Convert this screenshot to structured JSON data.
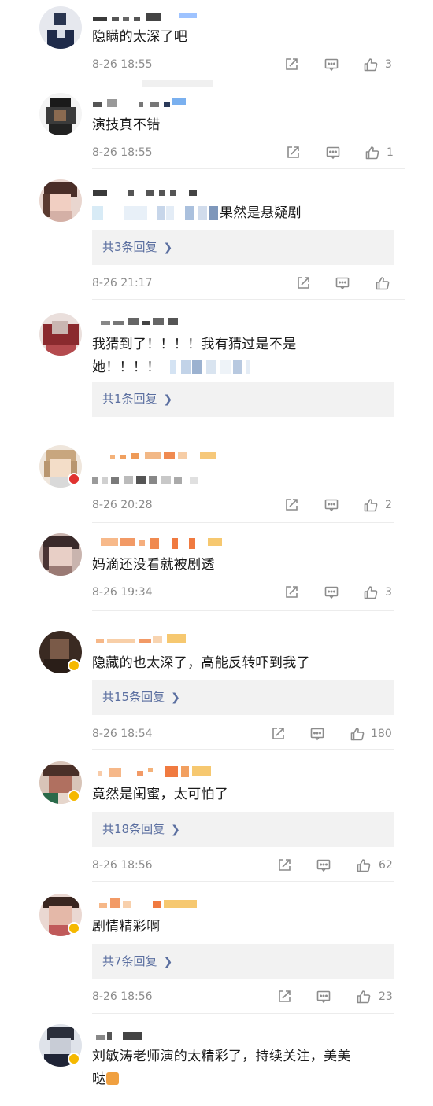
{
  "comments": [
    {
      "text": "隐瞒的太深了吧",
      "time": "8-26 18:55",
      "likes": "3"
    },
    {
      "text": "演技真不错",
      "time": "8-26 18:55",
      "likes": "1"
    },
    {
      "text": "果然是悬疑剧",
      "reply": "共3条回复",
      "time": "8-26 21:17",
      "likes": ""
    },
    {
      "text_line1": "我猜到了！！！！我有猜过是不是",
      "text_line2": "她！！！！",
      "reply": "共1条回复"
    },
    {
      "time": "8-26 20:28",
      "likes": "2"
    },
    {
      "text": "妈滴还没看就被剧透",
      "time": "8-26 19:34",
      "likes": "3"
    },
    {
      "text": "隐藏的也太深了，高能反转吓到我了",
      "reply": "共15条回复",
      "time": "8-26 18:54",
      "likes": "180"
    },
    {
      "text": "竟然是闺蜜，太可怕了",
      "reply": "共18条回复",
      "time": "8-26 18:56",
      "likes": "62"
    },
    {
      "text": "剧情精彩啊",
      "reply": "共7条回复",
      "time": "8-26 18:56",
      "likes": "23"
    },
    {
      "text_line1": "刘敏涛老师演的太精彩了，持续关注，美美",
      "text_line2": "哒"
    }
  ],
  "icons": {
    "repost": "repost-icon",
    "comment": "comment-icon",
    "like": "thumbs-up-icon",
    "reply_more": "chevron-right-icon"
  },
  "colors": {
    "link": "#5b6fa0",
    "meta": "#8c8c8c",
    "reply_bg": "#f2f2f2",
    "verified_badge": "#f5b800",
    "red_badge": "#e0322f"
  }
}
